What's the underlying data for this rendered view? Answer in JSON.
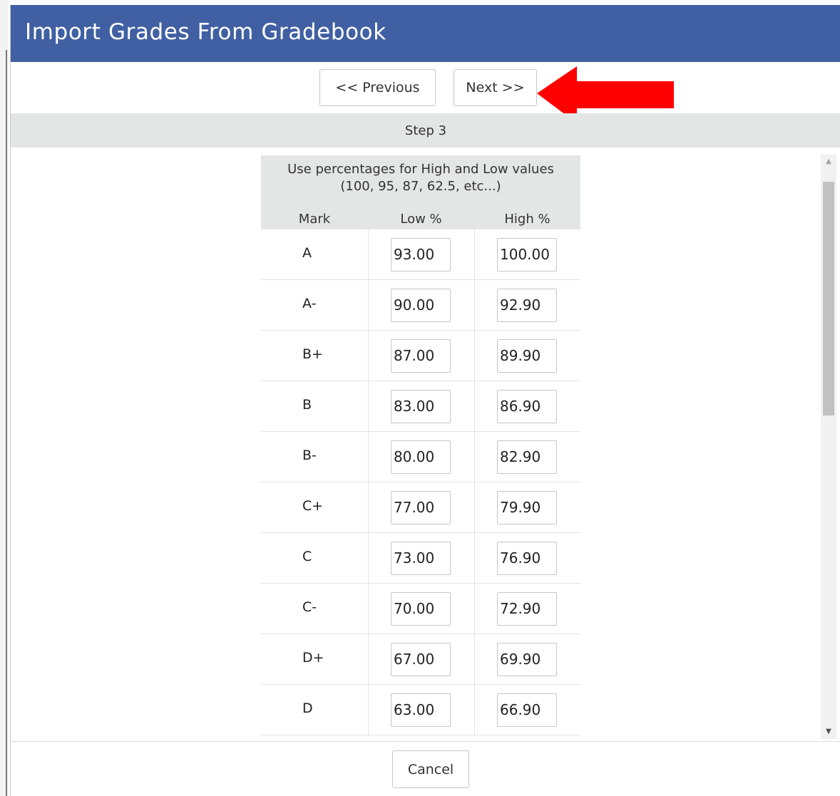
{
  "dialog": {
    "title": "Import Grades From Gradebook",
    "title_bar_color": "#4160a3"
  },
  "nav": {
    "previous_label": "<< Previous",
    "next_label": "Next >>"
  },
  "annotation": {
    "arrow_icon": "red-arrow-pointing-left",
    "arrow_color": "#ff0000"
  },
  "step": {
    "label": "Step 3"
  },
  "table": {
    "instruction_line1": "Use percentages for High and Low values",
    "instruction_line2": "(100, 95, 87, 62.5, etc...)",
    "headers": {
      "mark": "Mark",
      "low": "Low %",
      "high": "High %"
    },
    "rows": [
      {
        "mark": "A",
        "low": "93.00",
        "high": "100.00"
      },
      {
        "mark": "A-",
        "low": "90.00",
        "high": "92.90"
      },
      {
        "mark": "B+",
        "low": "87.00",
        "high": "89.90"
      },
      {
        "mark": "B",
        "low": "83.00",
        "high": "86.90"
      },
      {
        "mark": "B-",
        "low": "80.00",
        "high": "82.90"
      },
      {
        "mark": "C+",
        "low": "77.00",
        "high": "79.90"
      },
      {
        "mark": "C",
        "low": "73.00",
        "high": "76.90"
      },
      {
        "mark": "C-",
        "low": "70.00",
        "high": "72.90"
      },
      {
        "mark": "D+",
        "low": "67.00",
        "high": "69.90"
      },
      {
        "mark": "D",
        "low": "63.00",
        "high": "66.90"
      }
    ]
  },
  "footer": {
    "cancel_label": "Cancel"
  }
}
